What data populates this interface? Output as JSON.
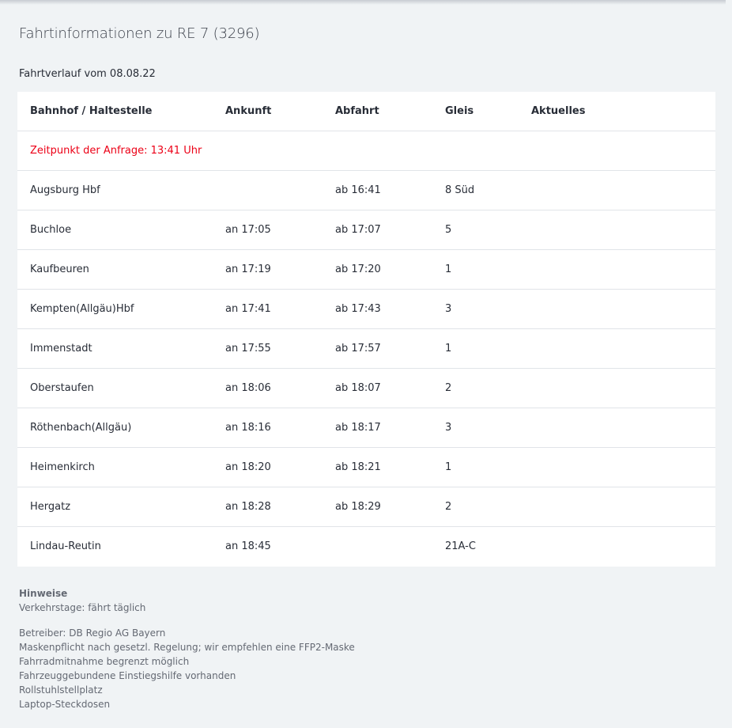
{
  "page_title": "Fahrtinformationen zu RE 7 (3296)",
  "subtitle": "Fahrtverlauf vom 08.08.22",
  "table": {
    "headers": {
      "station": "Bahnhof / Haltestelle",
      "arrival": "Ankunft",
      "departure": "Abfahrt",
      "platform": "Gleis",
      "current": "Aktuelles"
    },
    "query_time": "Zeitpunkt der Anfrage: 13:41 Uhr",
    "rows": [
      {
        "station": "Augsburg Hbf",
        "arrival": "",
        "departure": "ab 16:41",
        "platform": "8 Süd",
        "current": ""
      },
      {
        "station": "Buchloe",
        "arrival": "an 17:05",
        "departure": "ab 17:07",
        "platform": "5",
        "current": ""
      },
      {
        "station": "Kaufbeuren",
        "arrival": "an 17:19",
        "departure": "ab 17:20",
        "platform": "1",
        "current": ""
      },
      {
        "station": "Kempten(Allgäu)Hbf",
        "arrival": "an 17:41",
        "departure": "ab 17:43",
        "platform": "3",
        "current": ""
      },
      {
        "station": "Immenstadt",
        "arrival": "an 17:55",
        "departure": "ab 17:57",
        "platform": "1",
        "current": ""
      },
      {
        "station": "Oberstaufen",
        "arrival": "an 18:06",
        "departure": "ab 18:07",
        "platform": "2",
        "current": ""
      },
      {
        "station": "Röthenbach(Allgäu)",
        "arrival": "an 18:16",
        "departure": "ab 18:17",
        "platform": "3",
        "current": ""
      },
      {
        "station": "Heimenkirch",
        "arrival": "an 18:20",
        "departure": "ab 18:21",
        "platform": "1",
        "current": ""
      },
      {
        "station": "Hergatz",
        "arrival": "an 18:28",
        "departure": "ab 18:29",
        "platform": "2",
        "current": ""
      },
      {
        "station": "Lindau-Reutin",
        "arrival": "an 18:45",
        "departure": "",
        "platform": "21A-C",
        "current": ""
      }
    ]
  },
  "notes": {
    "title": "Hinweise",
    "traffic_days": "Verkehrstage: fährt täglich",
    "items": [
      "Betreiber: DB Regio AG Bayern",
      "Maskenpflicht nach gesetzl. Regelung; wir empfehlen eine FFP2-Maske",
      "Fahrradmitnahme begrenzt möglich",
      "Fahrzeuggebundene Einstiegshilfe vorhanden",
      "Rollstuhlstellplatz",
      "Laptop-Steckdosen"
    ]
  }
}
